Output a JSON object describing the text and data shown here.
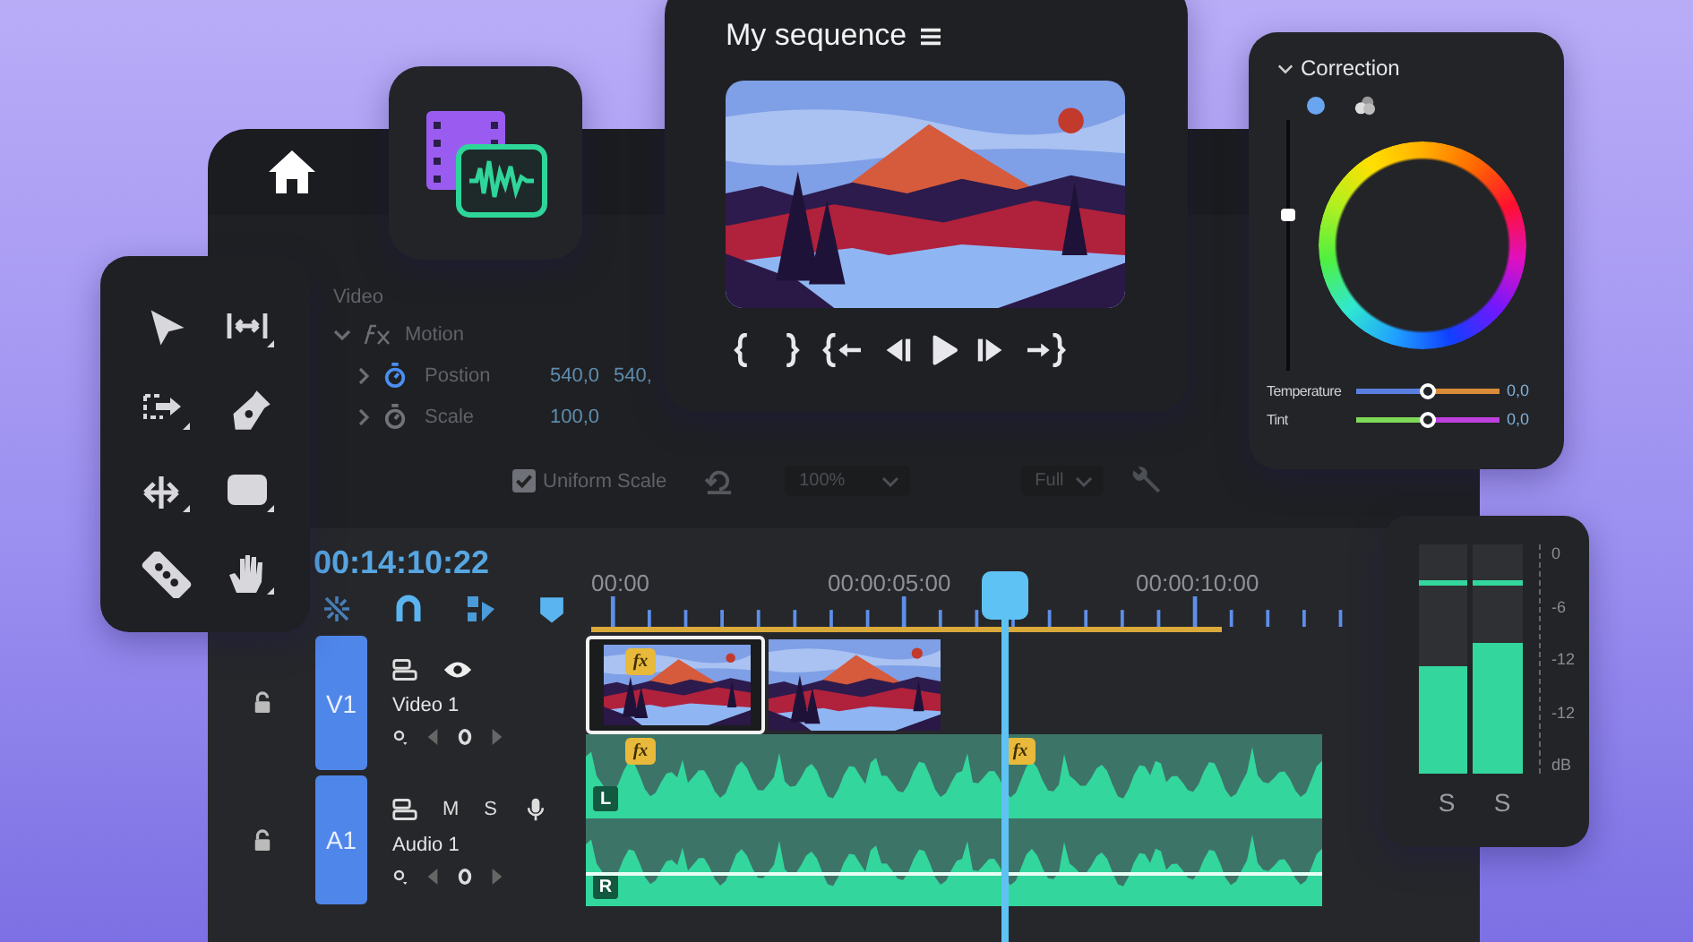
{
  "effect_controls": {
    "section": "Video",
    "effect": {
      "name": "Motion",
      "expanded": true
    },
    "properties": [
      {
        "name": "Postion",
        "animated": true,
        "expanded": false,
        "values": [
          "540,0",
          "540,"
        ]
      },
      {
        "name": "Scale",
        "animated": false,
        "expanded": false,
        "values": [
          "100,0"
        ]
      }
    ],
    "uniform_scale": {
      "label": "Uniform Scale",
      "checked": true
    },
    "zoom": "100%",
    "quality": "Full"
  },
  "program_monitor": {
    "title": "My sequence"
  },
  "correction": {
    "title": "Correction",
    "expanded": true,
    "luma": {
      "level": 0.62
    },
    "sliders": [
      {
        "kind": "temperature",
        "label": "Temperature",
        "level": 0.5,
        "reading": "0,0"
      },
      {
        "kind": "tint",
        "label": "Tint",
        "level": 0.5,
        "reading": "0,0"
      }
    ]
  },
  "timeline": {
    "timecode": "00:14:10:22",
    "ruler": [
      "00:00",
      "00:00:05:00",
      "00:00:10:00"
    ],
    "tracks": [
      {
        "kind": "video",
        "tag": "V1",
        "name": "Video 1"
      },
      {
        "kind": "audio",
        "tag": "A1",
        "name": "Audio 1",
        "buttons": [
          "M",
          "S"
        ]
      }
    ],
    "video_clips": [
      {
        "selected": true,
        "fx": "fx"
      },
      {
        "selected": false
      }
    ],
    "audio_clip": {
      "fx": [
        "fx",
        "fx"
      ],
      "channels": [
        "L",
        "R"
      ]
    }
  },
  "meters": {
    "scale": [
      "0",
      "-6",
      "-12",
      "-12",
      "dB"
    ],
    "channels": [
      {
        "level": 0.47,
        "label": "S"
      },
      {
        "level": 0.57,
        "label": "S"
      }
    ]
  }
}
